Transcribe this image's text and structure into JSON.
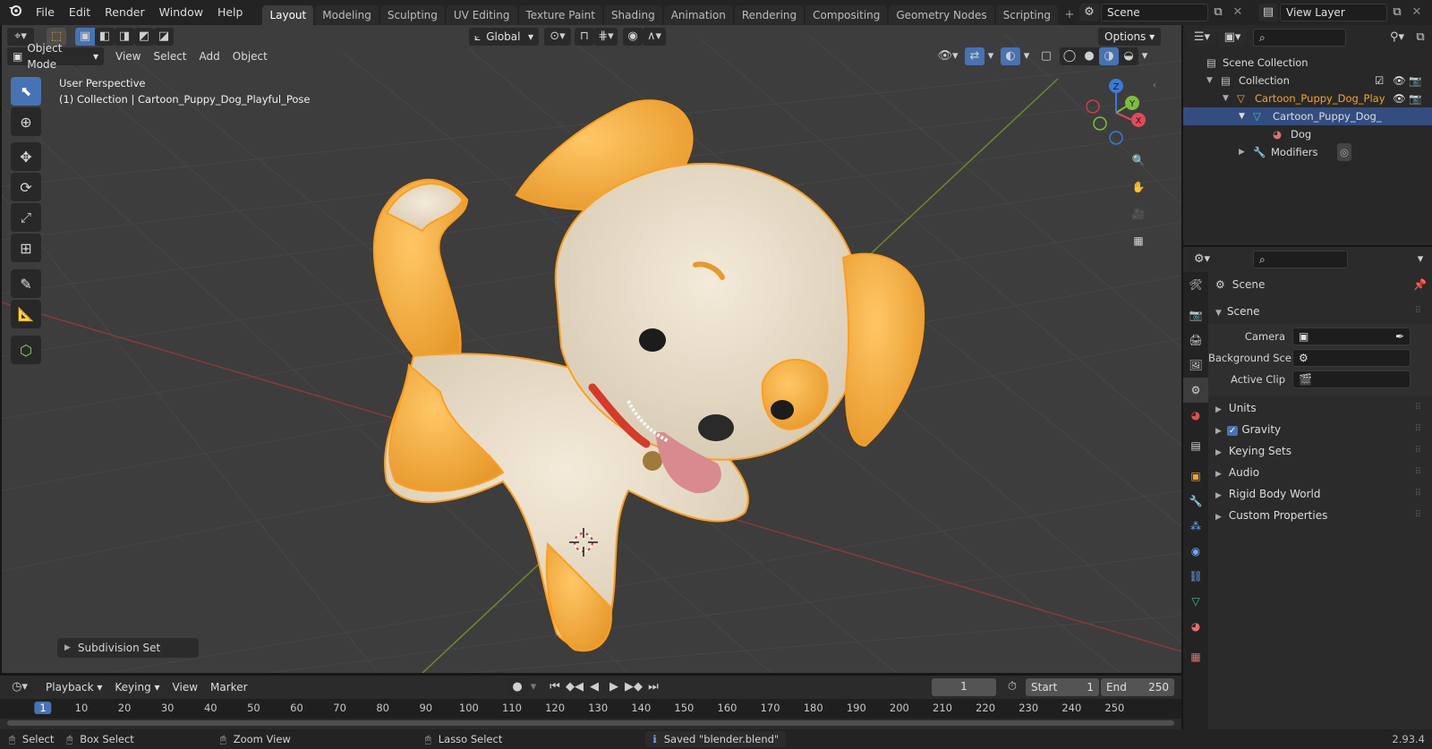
{
  "menu": [
    "File",
    "Edit",
    "Render",
    "Window",
    "Help"
  ],
  "workspaces": [
    "Layout",
    "Modeling",
    "Sculpting",
    "UV Editing",
    "Texture Paint",
    "Shading",
    "Animation",
    "Rendering",
    "Compositing",
    "Geometry Nodes",
    "Scripting"
  ],
  "scene_name": "Scene",
  "view_layer": "View Layer",
  "viewport": {
    "mode": "Object Mode",
    "menus": [
      "View",
      "Select",
      "Add",
      "Object"
    ],
    "transform_orientation": "Global",
    "options": "Options",
    "perspective": "User Perspective",
    "collection_info": "(1) Collection | Cartoon_Puppy_Dog_Playful_Pose",
    "last_op": "Subdivision Set",
    "gizmo": {
      "x": "X",
      "y": "Y",
      "z": "Z"
    }
  },
  "outliner": {
    "rows": [
      {
        "label": "Scene Collection"
      },
      {
        "label": "Collection"
      },
      {
        "label": "Cartoon_Puppy_Dog_Play"
      },
      {
        "label": "Cartoon_Puppy_Dog_"
      },
      {
        "label": "Dog"
      },
      {
        "label": "Modifiers"
      }
    ]
  },
  "properties": {
    "context": "Scene",
    "panel": "Scene",
    "fields": [
      {
        "label": "Camera"
      },
      {
        "label": "Background Sce..."
      },
      {
        "label": "Active Clip"
      }
    ],
    "sections": [
      "Units",
      "Gravity",
      "Keying Sets",
      "Audio",
      "Rigid Body World",
      "Custom Properties"
    ]
  },
  "timeline": {
    "menus": [
      "Playback",
      "Keying",
      "View",
      "Marker"
    ],
    "current_frame": "1",
    "start_label": "Start",
    "start": "1",
    "end_label": "End",
    "end": "250",
    "ticks": [
      "1",
      "10",
      "20",
      "30",
      "40",
      "50",
      "60",
      "70",
      "80",
      "90",
      "100",
      "110",
      "120",
      "130",
      "140",
      "150",
      "160",
      "170",
      "180",
      "190",
      "200",
      "210",
      "220",
      "230",
      "240",
      "250"
    ]
  },
  "status": {
    "select": "Select",
    "box_select": "Box Select",
    "zoom_view": "Zoom View",
    "lasso_select": "Lasso Select",
    "message": "Saved \"blender.blend\"",
    "version": "2.93.4"
  },
  "colors": {
    "accent": "#4772b3",
    "selected_orange": "#f5a623",
    "bg_viewport": "#3d3d3d"
  }
}
